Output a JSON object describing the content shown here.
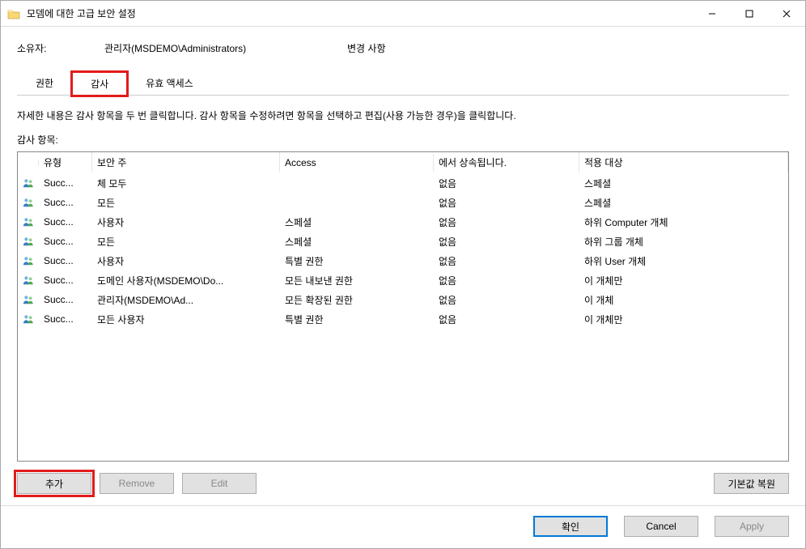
{
  "window": {
    "title": "모뎀에 대한 고급 보안 설정"
  },
  "owner": {
    "label": "소유자:",
    "value": "관리자(MSDEMO\\Administrators)",
    "change_label": "변경 사항"
  },
  "tabs": {
    "perm": "권한",
    "audit": "감사",
    "effective": "유효 액세스"
  },
  "description": "자세한 내용은 감사 항목을 두 번 클릭합니다. 감사 항목을 수정하려면 항목을 선택하고 편집(사용 가능한 경우)을 클릭합니다.",
  "subheading": "감사 항목:",
  "columns": {
    "type": "유형",
    "principal": "보안 주",
    "access": "Access",
    "inherit": "에서 상속됩니다.",
    "applies": "적용 대상"
  },
  "rows": [
    {
      "type": "Succ...",
      "principal": "체 모두",
      "access": "",
      "inherit": "없음",
      "applies": "스페셜"
    },
    {
      "type": "Succ...",
      "principal": "모든",
      "access": "",
      "inherit": "없음",
      "applies": "스페셜"
    },
    {
      "type": "Succ...",
      "principal": "사용자",
      "access": "스페셜",
      "inherit": "없음",
      "applies": "하위 Computer 개체"
    },
    {
      "type": "Succ...",
      "principal": "모든",
      "access": "스페셜",
      "inherit": "없음",
      "applies": "하위 그룹 개체"
    },
    {
      "type": "Succ...",
      "principal": "사용자",
      "access": "특별 권한",
      "inherit": "없음",
      "applies": "하위 User 개체"
    },
    {
      "type": "Succ...",
      "principal": "도메인 사용자(MSDEMO\\Do...",
      "access": "모든 내보낸 권한",
      "inherit": "없음",
      "applies": "  이 개체만"
    },
    {
      "type": "Succ...",
      "principal": "관리자(MSDEMO\\Ad...",
      "access": "모든 확장된 권한",
      "inherit": "없음",
      "applies": "  이 개체"
    },
    {
      "type": "Succ...",
      "principal": "모든 사용자",
      "access": "특별 권한",
      "inherit": "없음",
      "applies": "이 개체만"
    }
  ],
  "buttons": {
    "add": "추가",
    "remove": "Remove",
    "edit": "Edit",
    "restore": "기본값 복원",
    "ok": "확인",
    "cancel": "Cancel",
    "apply": "Apply"
  }
}
